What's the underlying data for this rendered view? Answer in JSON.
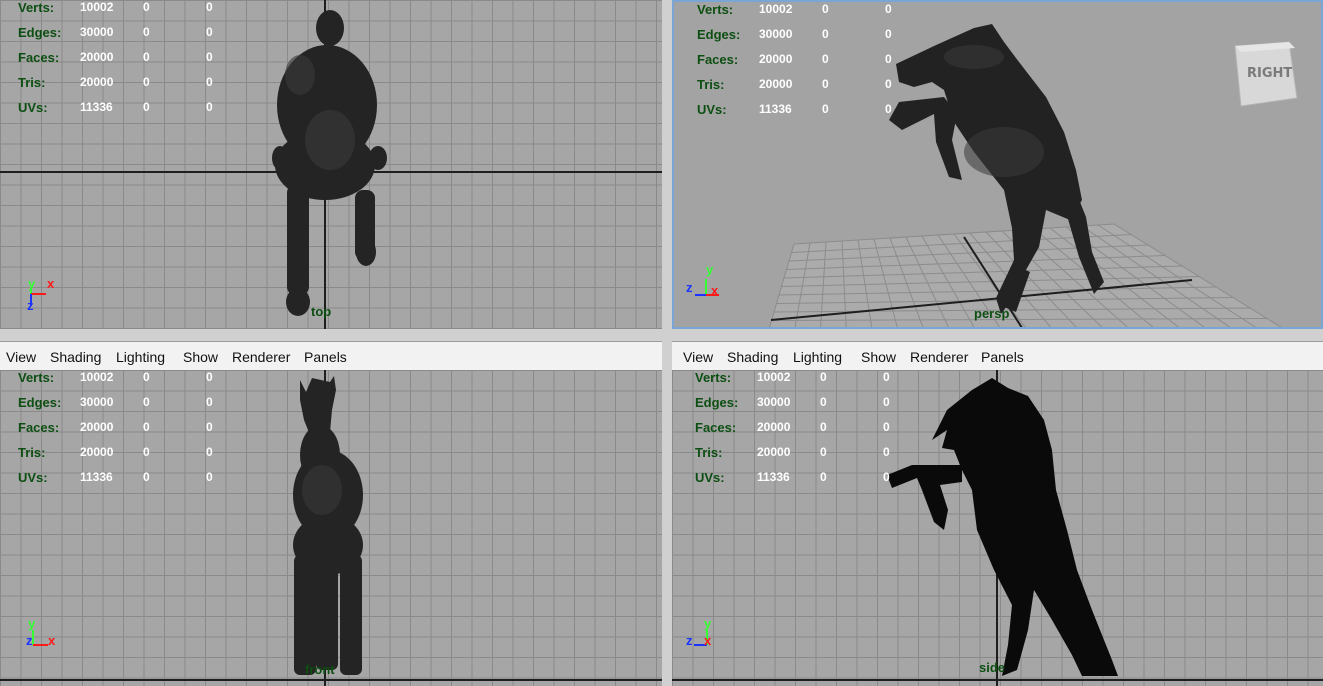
{
  "hud": {
    "labels": [
      "Verts:",
      "Edges:",
      "Faces:",
      "Tris:",
      "UVs:"
    ],
    "rows": [
      [
        "10002",
        "0",
        "0"
      ],
      [
        "30000",
        "0",
        "0"
      ],
      [
        "20000",
        "0",
        "0"
      ],
      [
        "20000",
        "0",
        "0"
      ],
      [
        "11336",
        "0",
        "0"
      ]
    ]
  },
  "viewports": {
    "top": {
      "camera": "top"
    },
    "persp": {
      "camera": "persp",
      "viewcube": "RIGHT"
    },
    "front": {
      "camera": "front"
    },
    "side": {
      "camera": "side"
    }
  },
  "menu": [
    "View",
    "Shading",
    "Lighting",
    "Show",
    "Renderer",
    "Panels"
  ],
  "axes": {
    "x": "x",
    "y": "y",
    "z": "z"
  },
  "colors": {
    "grid_bg": "#a6a6a6",
    "hud_label": "#0d4f12",
    "x_axis": "#ff1a1a",
    "y_axis": "#33ff33",
    "z_axis": "#1a33ff",
    "active_border": "#7aa6d6"
  }
}
